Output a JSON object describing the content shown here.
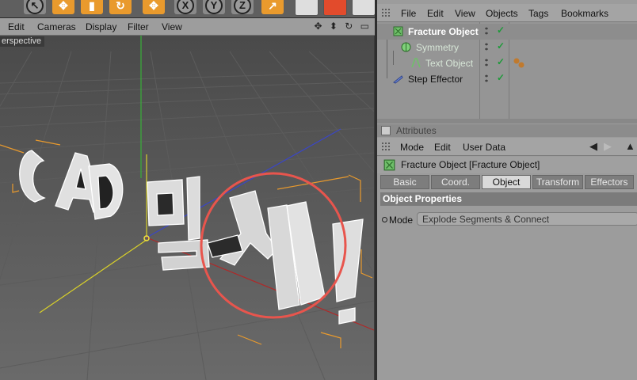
{
  "toolbar": {
    "buttons": [
      {
        "name": "live-selection-tool",
        "glyph": "↖"
      },
      {
        "name": "move-tool",
        "glyph": "✥"
      },
      {
        "name": "scale-tool",
        "glyph": "▮"
      },
      {
        "name": "rotate-tool",
        "glyph": "↻"
      },
      {
        "name": "recent-tool",
        "glyph": "✥"
      },
      {
        "name": "x-axis-lock",
        "glyph": "X"
      },
      {
        "name": "y-axis-lock",
        "glyph": "Y"
      },
      {
        "name": "z-axis-lock",
        "glyph": "Z"
      },
      {
        "name": "world-coordinates",
        "glyph": "↗"
      },
      {
        "name": "render-view",
        "glyph": ""
      },
      {
        "name": "render-to-picture-viewer",
        "glyph": ""
      },
      {
        "name": "render-settings",
        "glyph": ""
      }
    ]
  },
  "viewport": {
    "menu": [
      "Edit",
      "Cameras",
      "Display",
      "Filter",
      "View"
    ],
    "camera_label": "erspective",
    "nav_icons": "✥ ⬍ ↻ ▭"
  },
  "object_manager": {
    "menu": [
      "File",
      "Edit",
      "View",
      "Objects",
      "Tags",
      "Bookmarks"
    ],
    "objects": [
      {
        "label": "Fracture Object",
        "icon": "fracture-object-icon",
        "color": "#ffffff"
      },
      {
        "label": "Symmetry",
        "icon": "symmetry-icon",
        "color": "#d7e6d7"
      },
      {
        "label": "Text Object",
        "icon": "text-object-icon",
        "color": "#d7e6d7"
      },
      {
        "label": "Step Effector",
        "icon": "step-effector-icon",
        "color": "#111111"
      }
    ],
    "check_glyph": "✓"
  },
  "attributes": {
    "header": "Attributes",
    "menu": [
      "Mode",
      "Edit",
      "User Data"
    ],
    "title": "Fracture Object [Fracture Object]",
    "tabs": [
      "Basic",
      "Coord.",
      "Object",
      "Transform",
      "Effectors"
    ],
    "active_tab": "Object",
    "section": "Object Properties",
    "mode_label": "Mode",
    "mode_value": "Explode Segments & Connect"
  },
  "colors": {
    "accent_orange": "#e99a2d",
    "highlight_circle": "#e8554d",
    "check_green": "#1f9a3a",
    "viewport_bg": "#505050"
  }
}
